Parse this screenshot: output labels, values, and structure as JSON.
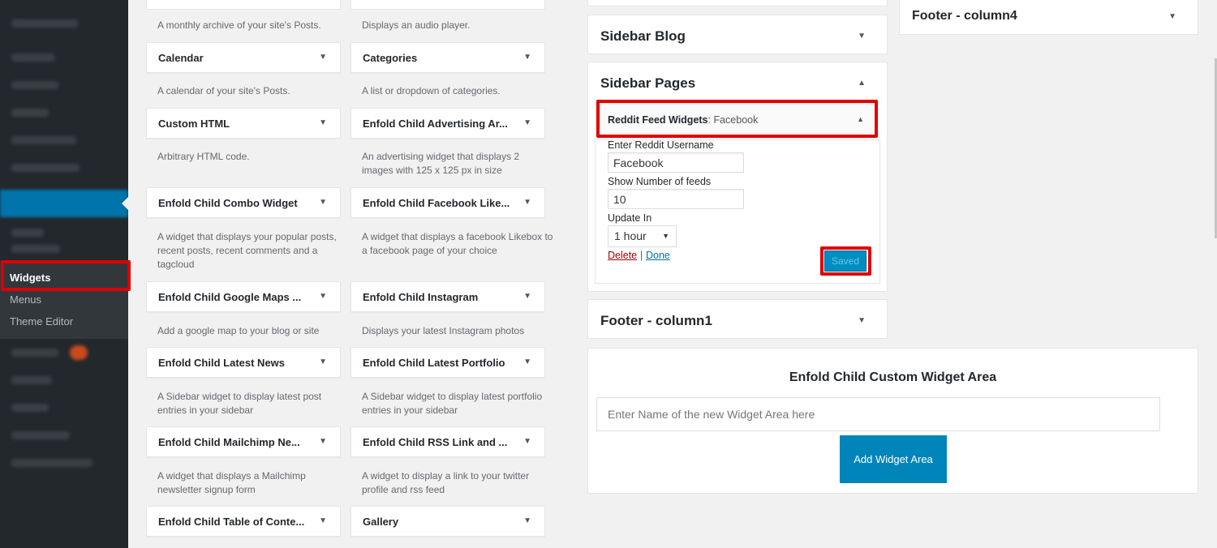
{
  "admin_menu": {
    "current_item": "Widgets",
    "items": [
      "Widgets",
      "Menus",
      "Theme Editor"
    ]
  },
  "widgets_left": [
    {
      "title": "Calendar",
      "desc": "A calendar of your site's Posts."
    },
    {
      "title": "Custom HTML",
      "desc": "Arbitrary HTML code."
    },
    {
      "title": "Enfold Child Combo Widget",
      "desc": "A widget that displays your popular posts, recent posts, recent comments and a tagcloud"
    },
    {
      "title": "Enfold Child Google Maps ...",
      "desc": "Add a google map to your blog or site"
    },
    {
      "title": "Enfold Child Latest News",
      "desc": "A Sidebar widget to display latest post entries in your sidebar"
    },
    {
      "title": "Enfold Child Mailchimp Ne...",
      "desc": "A widget that displays a Mailchimp newsletter signup form"
    },
    {
      "title": "Enfold Child Table of Conte...",
      "desc": ""
    }
  ],
  "widgets_right": [
    {
      "title": "Categories",
      "desc": "A list or dropdown of categories."
    },
    {
      "title": "Enfold Child Advertising Ar...",
      "desc": "An advertising widget that displays 2 images with 125 x 125 px in size"
    },
    {
      "title": "Enfold Child Facebook Like...",
      "desc": "A widget that displays a facebook Likebox to a facebook page of your choice"
    },
    {
      "title": "Enfold Child Instagram",
      "desc": "Displays your latest Instagram photos"
    },
    {
      "title": "Enfold Child Latest Portfolio",
      "desc": "A Sidebar widget to display latest portfolio entries in your sidebar"
    },
    {
      "title": "Enfold Child RSS Link and ...",
      "desc": "A widget to display a link to your twitter profile and rss feed"
    },
    {
      "title": "Gallery",
      "desc": ""
    }
  ],
  "top_descs": {
    "left": "A monthly archive of your site's Posts.",
    "right": "Displays an audio player."
  },
  "areas": {
    "sidebar_blog": "Sidebar Blog",
    "sidebar_pages": "Sidebar Pages",
    "footer_col1": "Footer - column1",
    "footer_col4": "Footer - column4"
  },
  "reddit_widget": {
    "title_bold": "Reddit Feed Widgets",
    "title_suffix": ": Facebook",
    "username_label": "Enter Reddit Username",
    "username_value": "Facebook",
    "feeds_label": "Show Number of feeds",
    "feeds_value": "10",
    "update_label": "Update In",
    "update_value": "1 hour",
    "delete_label": "Delete",
    "separator": "|",
    "done_label": "Done",
    "saved_label": "Saved"
  },
  "custom_area": {
    "title": "Enfold Child Custom Widget Area",
    "input_placeholder": "Enter Name of the new Widget Area here",
    "button_label": "Add Widget Area"
  },
  "icons": {
    "collapse": "triangle-down-icon",
    "expand": "triangle-up-icon",
    "select": "triangle-down-icon"
  },
  "colors": {
    "admin_bg": "#23282d",
    "admin_blue": "#0073aa",
    "highlight_red": "#e00000",
    "button_blue": "#0085ba"
  }
}
